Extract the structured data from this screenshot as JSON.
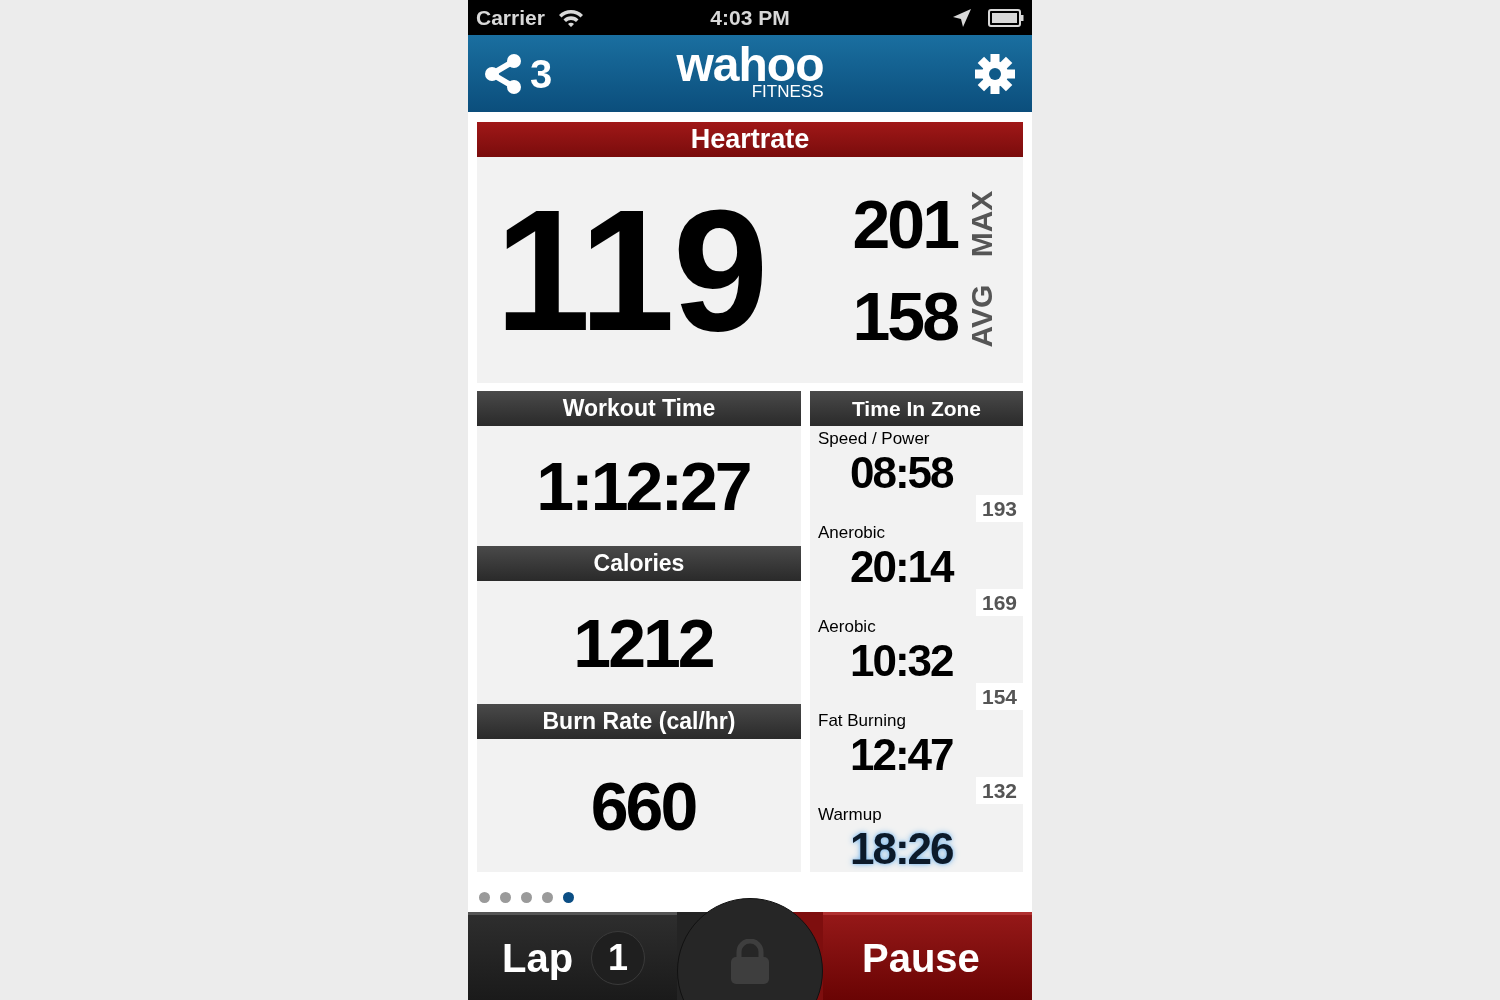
{
  "status_bar": {
    "carrier": "Carrier",
    "time": "4:03 PM"
  },
  "nav": {
    "share_count": "3",
    "logo": "wahoo",
    "logo_sub": "FITNESS"
  },
  "heartrate": {
    "title": "Heartrate",
    "value": "119",
    "stats": [
      {
        "value": "201",
        "label": "MAX"
      },
      {
        "value": "158",
        "label": "AVG"
      }
    ]
  },
  "metrics": [
    {
      "title": "Workout Time",
      "value": "1:12:27"
    },
    {
      "title": "Calories",
      "value": "1212"
    },
    {
      "title": "Burn Rate (cal/hr)",
      "value": "660"
    }
  ],
  "time_in_zone": {
    "title": "Time In Zone",
    "zones": [
      {
        "name": "Speed / Power",
        "time": "08:58",
        "threshold": "193",
        "current": false
      },
      {
        "name": "Anerobic",
        "time": "20:14",
        "threshold": "169",
        "current": false
      },
      {
        "name": "Aerobic",
        "time": "10:32",
        "threshold": "154",
        "current": false
      },
      {
        "name": "Fat Burning",
        "time": "12:47",
        "threshold": "132",
        "current": false
      },
      {
        "name": "Warmup",
        "time": "18:26",
        "current": true
      }
    ]
  },
  "page_dots": [
    {
      "selected": false
    },
    {
      "selected": false
    },
    {
      "selected": false
    },
    {
      "selected": false
    },
    {
      "selected": true
    }
  ],
  "bottom_bar": {
    "lap_label": "Lap",
    "lap_count": "1",
    "pause_label": "Pause"
  }
}
